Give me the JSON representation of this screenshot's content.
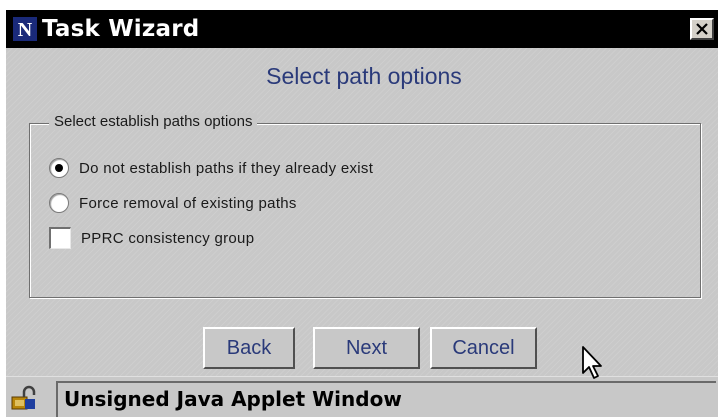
{
  "window": {
    "title": "Task Wizard",
    "app_icon": "netscape-n-icon",
    "close_icon": "close-x-icon"
  },
  "page": {
    "heading": "Select path options"
  },
  "group": {
    "legend": "Select establish paths options",
    "options": [
      {
        "label": "Do not establish paths if they already exist",
        "type": "radio",
        "checked": true
      },
      {
        "label": "Force removal of existing paths",
        "type": "radio",
        "checked": false
      },
      {
        "label": "PPRC consistency group",
        "type": "checkbox",
        "checked": false
      }
    ]
  },
  "buttons": {
    "back": "Back",
    "next": "Next",
    "cancel": "Cancel"
  },
  "status": {
    "text": "Unsigned Java Applet Window",
    "icon": "unlocked-padlock-icon"
  },
  "colors": {
    "title_bar": "#000000",
    "panel": "#c8c8c8",
    "label_blue": "#2a3a7a"
  }
}
